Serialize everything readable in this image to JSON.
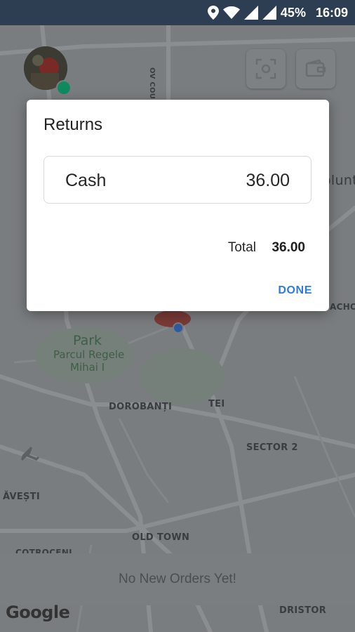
{
  "status_bar": {
    "battery": "45%",
    "time": "16:09",
    "icons": [
      "location-icon",
      "wifi-icon",
      "signal-icon",
      "signal-icon",
      "battery-percent"
    ]
  },
  "map": {
    "labels": {
      "dorobanti": "DOROBANȚI",
      "tei": "TEI",
      "sector2": "SECTOR 2",
      "avesti": "ĂVEȘTI",
      "old_town": "OLD TOWN",
      "cotroceni": "COTROCENI",
      "dristor": "DRISTOR",
      "park": "Park",
      "park_name_line1": "Parcul Regele",
      "park_name_line2": "Mihai I",
      "road_vertical": "OV COUNTY",
      "right_edge_1": "olunt",
      "right_edge_2": "ACHO"
    },
    "google": "Google"
  },
  "bottom_bar": {
    "message": "No New Orders Yet!"
  },
  "dialog": {
    "title": "Returns",
    "payment_method": "Cash",
    "payment_amount": "36.00",
    "total_label": "Total",
    "total_value": "36.00",
    "done_label": "DONE"
  },
  "colors": {
    "accent": "#2a7be4",
    "status_bar": "#2e3e52",
    "online_dot": "#0f8a5f"
  }
}
